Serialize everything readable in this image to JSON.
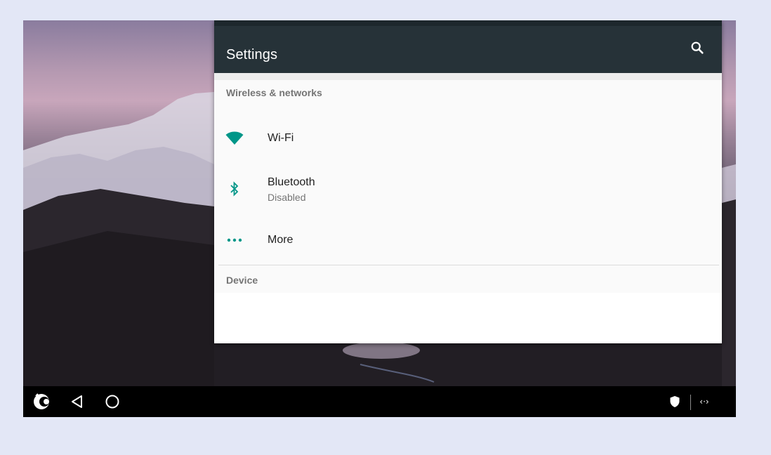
{
  "settings": {
    "title": "Settings",
    "search_icon": "search-icon",
    "categories": {
      "wireless": "Wireless & networks",
      "device": "Device"
    },
    "items": [
      {
        "title": "Wi-Fi",
        "icon": "wifi-icon"
      },
      {
        "title": "Bluetooth",
        "summary": "Disabled",
        "icon": "bluetooth-icon"
      },
      {
        "title": "More",
        "icon": "more-dots-icon"
      }
    ],
    "accent_color": "#009688",
    "toolbar_color": "#263238"
  },
  "navigation": {
    "icons": [
      "launcher-logo-icon",
      "back-icon",
      "home-icon",
      "shield-icon",
      "remote-connection-icon"
    ],
    "remote_label": "‹·›"
  }
}
